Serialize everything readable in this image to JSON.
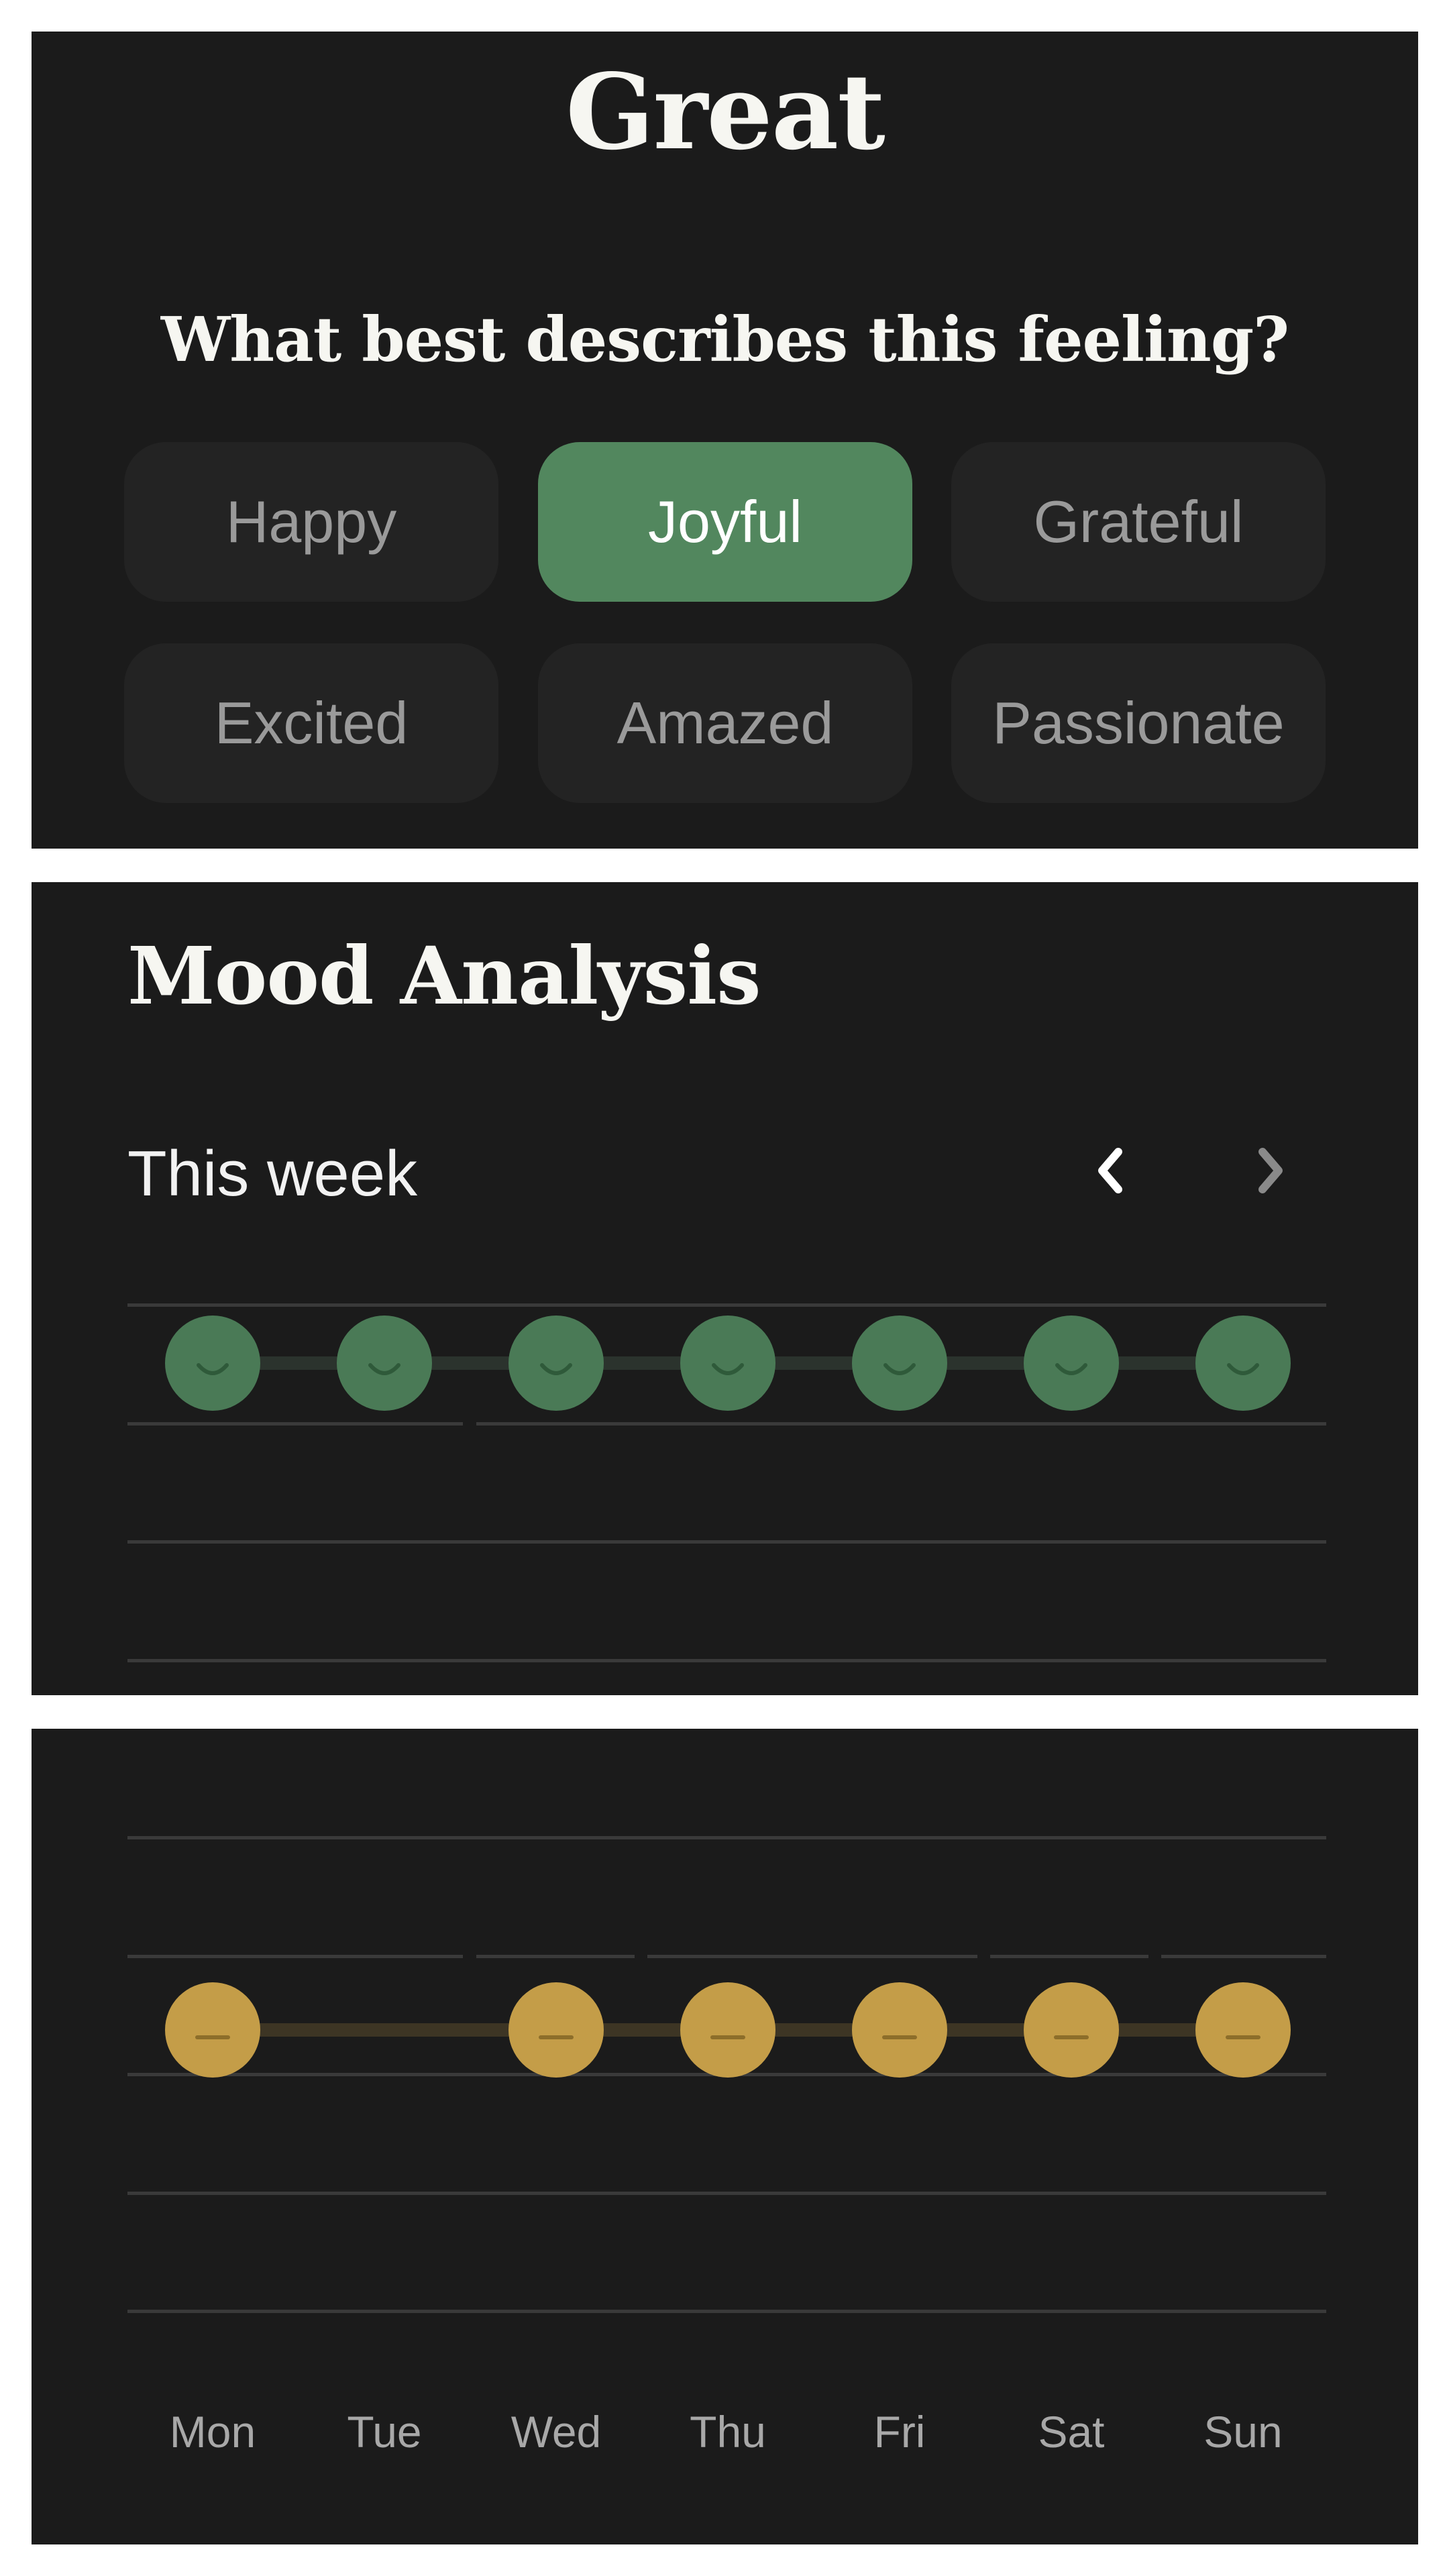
{
  "feeling_card": {
    "mood_title": "Great",
    "question": "What best describes this feeling?",
    "options": [
      "Happy",
      "Joyful",
      "Grateful",
      "Excited",
      "Amazed",
      "Passionate"
    ],
    "selected": "Joyful"
  },
  "analysis": {
    "title": "Mood Analysis",
    "range_label": "This week",
    "prev_icon": "chevron-left-icon",
    "next_icon": "chevron-right-icon"
  },
  "chart": {
    "days": [
      "Mon",
      "Tue",
      "Wed",
      "Thu",
      "Fri",
      "Sat",
      "Sun"
    ]
  },
  "colors": {
    "accent_green": "#52875e",
    "mood_dot_green": "#4a7a56",
    "mood_dot_yellow": "#c49d48",
    "panel_bg": "#1b1b1b"
  },
  "chart_data": [
    {
      "type": "line",
      "categories": [
        "Mon",
        "Tue",
        "Wed",
        "Thu",
        "Fri",
        "Sat",
        "Sun"
      ],
      "series": [
        {
          "values": [
            "happy",
            "happy",
            "happy",
            "happy",
            "happy",
            "happy",
            "happy"
          ]
        }
      ]
    },
    {
      "type": "line",
      "categories": [
        "Mon",
        "Tue",
        "Wed",
        "Thu",
        "Fri",
        "Sat",
        "Sun"
      ],
      "series": [
        {
          "values": [
            "neutral",
            null,
            "neutral",
            "neutral",
            "neutral",
            "neutral",
            "neutral"
          ]
        }
      ]
    }
  ]
}
